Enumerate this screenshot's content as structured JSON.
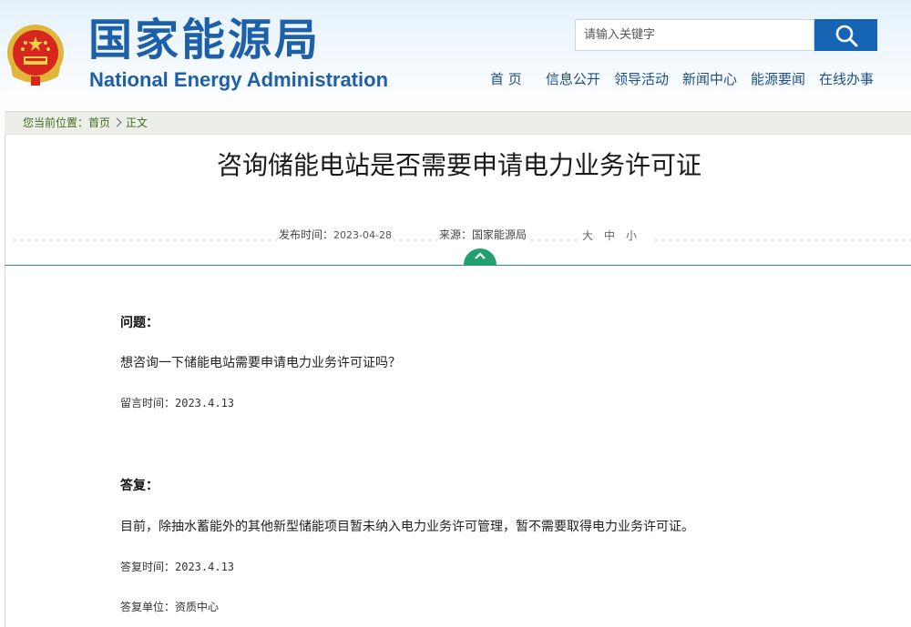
{
  "header": {
    "logo_cn": "国家能源局",
    "logo_en": "National Energy Administration",
    "search": {
      "placeholder": "请输入关键字"
    },
    "nav": [
      {
        "label": "首 页"
      },
      {
        "label": "信息公开"
      },
      {
        "label": "领导活动"
      },
      {
        "label": "新闻中心"
      },
      {
        "label": "能源要闻"
      },
      {
        "label": "在线办事"
      }
    ]
  },
  "breadcrumb": {
    "prefix": "您当前位置：",
    "home": "首页",
    "current": "正文"
  },
  "article": {
    "title": "咨询储能电站是否需要申请电力业务许可证",
    "publish_label": "发布时间：",
    "publish_date": "2023-04-28",
    "source_label": "来源：",
    "source": "国家能源局",
    "font_sizes": [
      "大",
      "中",
      "小"
    ],
    "question_label": "问题：",
    "question_text": "想咨询一下储能电站需要申请电力业务许可证吗？",
    "question_time": "留言时间：2023.4.13",
    "answer_label": "答复：",
    "answer_text": "目前，除抽水蓄能外的其他新型储能项目暂未纳入电力业务许可管理，暂不需要取得电力业务许可证。",
    "answer_time": "答复时间：2023.4.13",
    "answer_unit": "答复单位：资质中心"
  },
  "colors": {
    "brand_blue": "#1d5fa8",
    "search_button": "#1565b4",
    "accent_green": "#22a16e",
    "breadcrumb_green": "#3e6f1e"
  },
  "icons": {
    "emblem": "national-emblem-icon",
    "search": "search-icon",
    "toggle": "chevron-up-icon"
  }
}
